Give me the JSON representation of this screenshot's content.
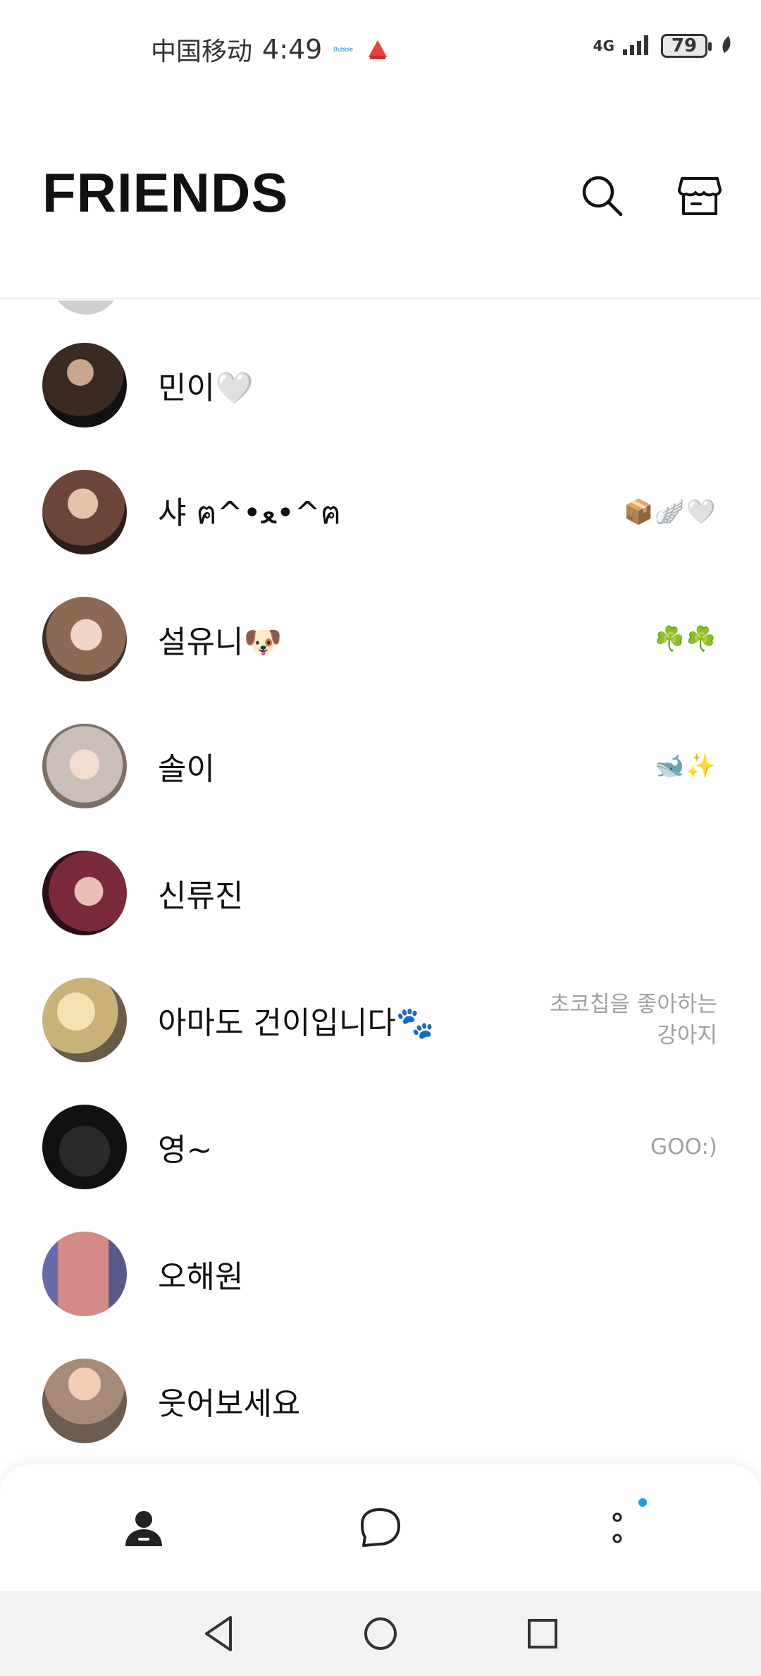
{
  "status_bar": {
    "carrier": "中国移动",
    "time": "4:49",
    "network": "4G",
    "battery": "79"
  },
  "header": {
    "title": "FRIENDS"
  },
  "friends": [
    {
      "name": "민이🤍",
      "status": "",
      "avatar_color": "#3a2a22"
    },
    {
      "name": "샤 ฅ^•ﻌ•^ฅ",
      "status": "📦🪽🤍",
      "avatar_color": "#6b4638"
    },
    {
      "name": "설유니🐶",
      "status": "☘️☘️",
      "avatar_color": "#8a6a55"
    },
    {
      "name": "솔이",
      "status": "🐋✨",
      "avatar_color": "#b9aaa0"
    },
    {
      "name": "신류진",
      "status": "",
      "avatar_color": "#7a2a3a"
    },
    {
      "name": "아마도 건이입니다🐾",
      "status_lines": [
        "초코칩을 좋아하는",
        "강아지"
      ],
      "avatar_color": "#c9b27a"
    },
    {
      "name": "영~",
      "status": "GOO:)",
      "avatar_color": "#1a1a1a"
    },
    {
      "name": "오해원",
      "status": "",
      "avatar_color": "#d48a86"
    },
    {
      "name": "웃어보세요",
      "status": "",
      "avatar_color": "#a88a78"
    }
  ],
  "colors": {
    "text_primary": "#111111",
    "text_secondary": "#a0a0a0",
    "badge_dot": "#1aa0e8",
    "divider": "#eeeeee"
  },
  "icons": {
    "search": "search-icon",
    "shop": "shop-icon",
    "friends_tab": "person-icon",
    "chats_tab": "chat-bubble-icon",
    "more_tab": "more-dots-icon",
    "back": "back-triangle-icon",
    "home": "home-circle-icon",
    "recents": "recents-square-icon"
  }
}
